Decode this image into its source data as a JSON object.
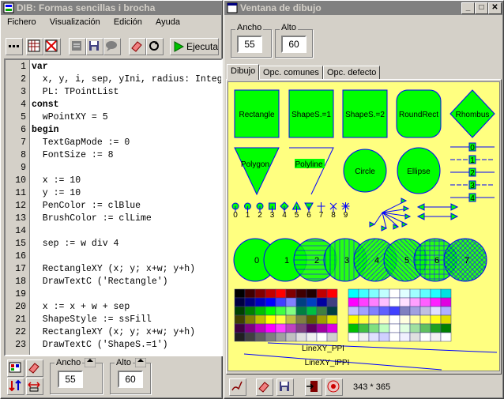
{
  "left_window": {
    "title": "DIB: Formas sencillas i brocha",
    "menu": [
      "Fichero",
      "Visualización",
      "Edición",
      "Ayuda"
    ],
    "run_button": "Ejecuta",
    "code_lines": [
      {
        "n": "1",
        "t": "var",
        "cls": "kw"
      },
      {
        "n": "2",
        "t": "  x, y, i, sep, yIni, radius: Integ"
      },
      {
        "n": "3",
        "t": "  PL: TPointList"
      },
      {
        "n": "4",
        "t": "const",
        "cls": "kw"
      },
      {
        "n": "5",
        "t": "  wPointXY = 5"
      },
      {
        "n": "6",
        "t": "begin",
        "cls": "kw"
      },
      {
        "n": "7",
        "t": "  TextGapMode := 0"
      },
      {
        "n": "8",
        "t": "  FontSize := 8"
      },
      {
        "n": "9",
        "t": ""
      },
      {
        "n": "10",
        "t": "  x := 10"
      },
      {
        "n": "11",
        "t": "  y := 10"
      },
      {
        "n": "12",
        "t": "  PenColor := clBlue"
      },
      {
        "n": "13",
        "t": "  BrushColor := clLime"
      },
      {
        "n": "14",
        "t": ""
      },
      {
        "n": "15",
        "t": "  sep := w div 4"
      },
      {
        "n": "16",
        "t": ""
      },
      {
        "n": "17",
        "t": "  RectangleXY (x; y; x+w; y+h)"
      },
      {
        "n": "18",
        "t": "  DrawTextC ('Rectangle')"
      },
      {
        "n": "19",
        "t": ""
      },
      {
        "n": "20",
        "t": "  x := x + w + sep"
      },
      {
        "n": "21",
        "t": "  ShapeStyle := ssFill"
      },
      {
        "n": "22",
        "t": "  RectangleXY (x; y; x+w; y+h)"
      },
      {
        "n": "23",
        "t": "  DrawTextC ('ShapeS.=1')"
      }
    ],
    "ancho_label": "Ancho",
    "ancho_value": "55",
    "alto_label": "Alto",
    "alto_value": "60"
  },
  "right_window": {
    "title": "Ventana de dibujo",
    "ancho_label": "Ancho",
    "ancho_value": "55",
    "alto_label": "Alto",
    "alto_value": "60",
    "tabs": [
      "Dibujo",
      "Opc. comunes",
      "Opc. defecto"
    ],
    "status": "343 * 365",
    "shapes": {
      "row1": [
        "Rectangle",
        "ShapeS.=1",
        "ShapeS.=2",
        "RoundRect",
        "Rhombus"
      ],
      "row2": [
        "Polygon",
        "Polyline",
        "Circle",
        "Ellipse"
      ],
      "markers": [
        "0",
        "1",
        "2",
        "3",
        "4",
        "5",
        "6",
        "7",
        "8",
        "9"
      ],
      "ticks": [
        "0",
        "1",
        "2",
        "3",
        "4"
      ],
      "circles": [
        "0",
        "1",
        "2",
        "3",
        "4",
        "5",
        "6",
        "7"
      ],
      "line1": "LineXY_PPI",
      "line2": "LineXY_IPPI"
    }
  },
  "colors": {
    "canvas_bg": "#ffff80",
    "shape_fill": "#00ff00",
    "pen": "#0000ff",
    "titlebar_inactive": "#808080"
  }
}
